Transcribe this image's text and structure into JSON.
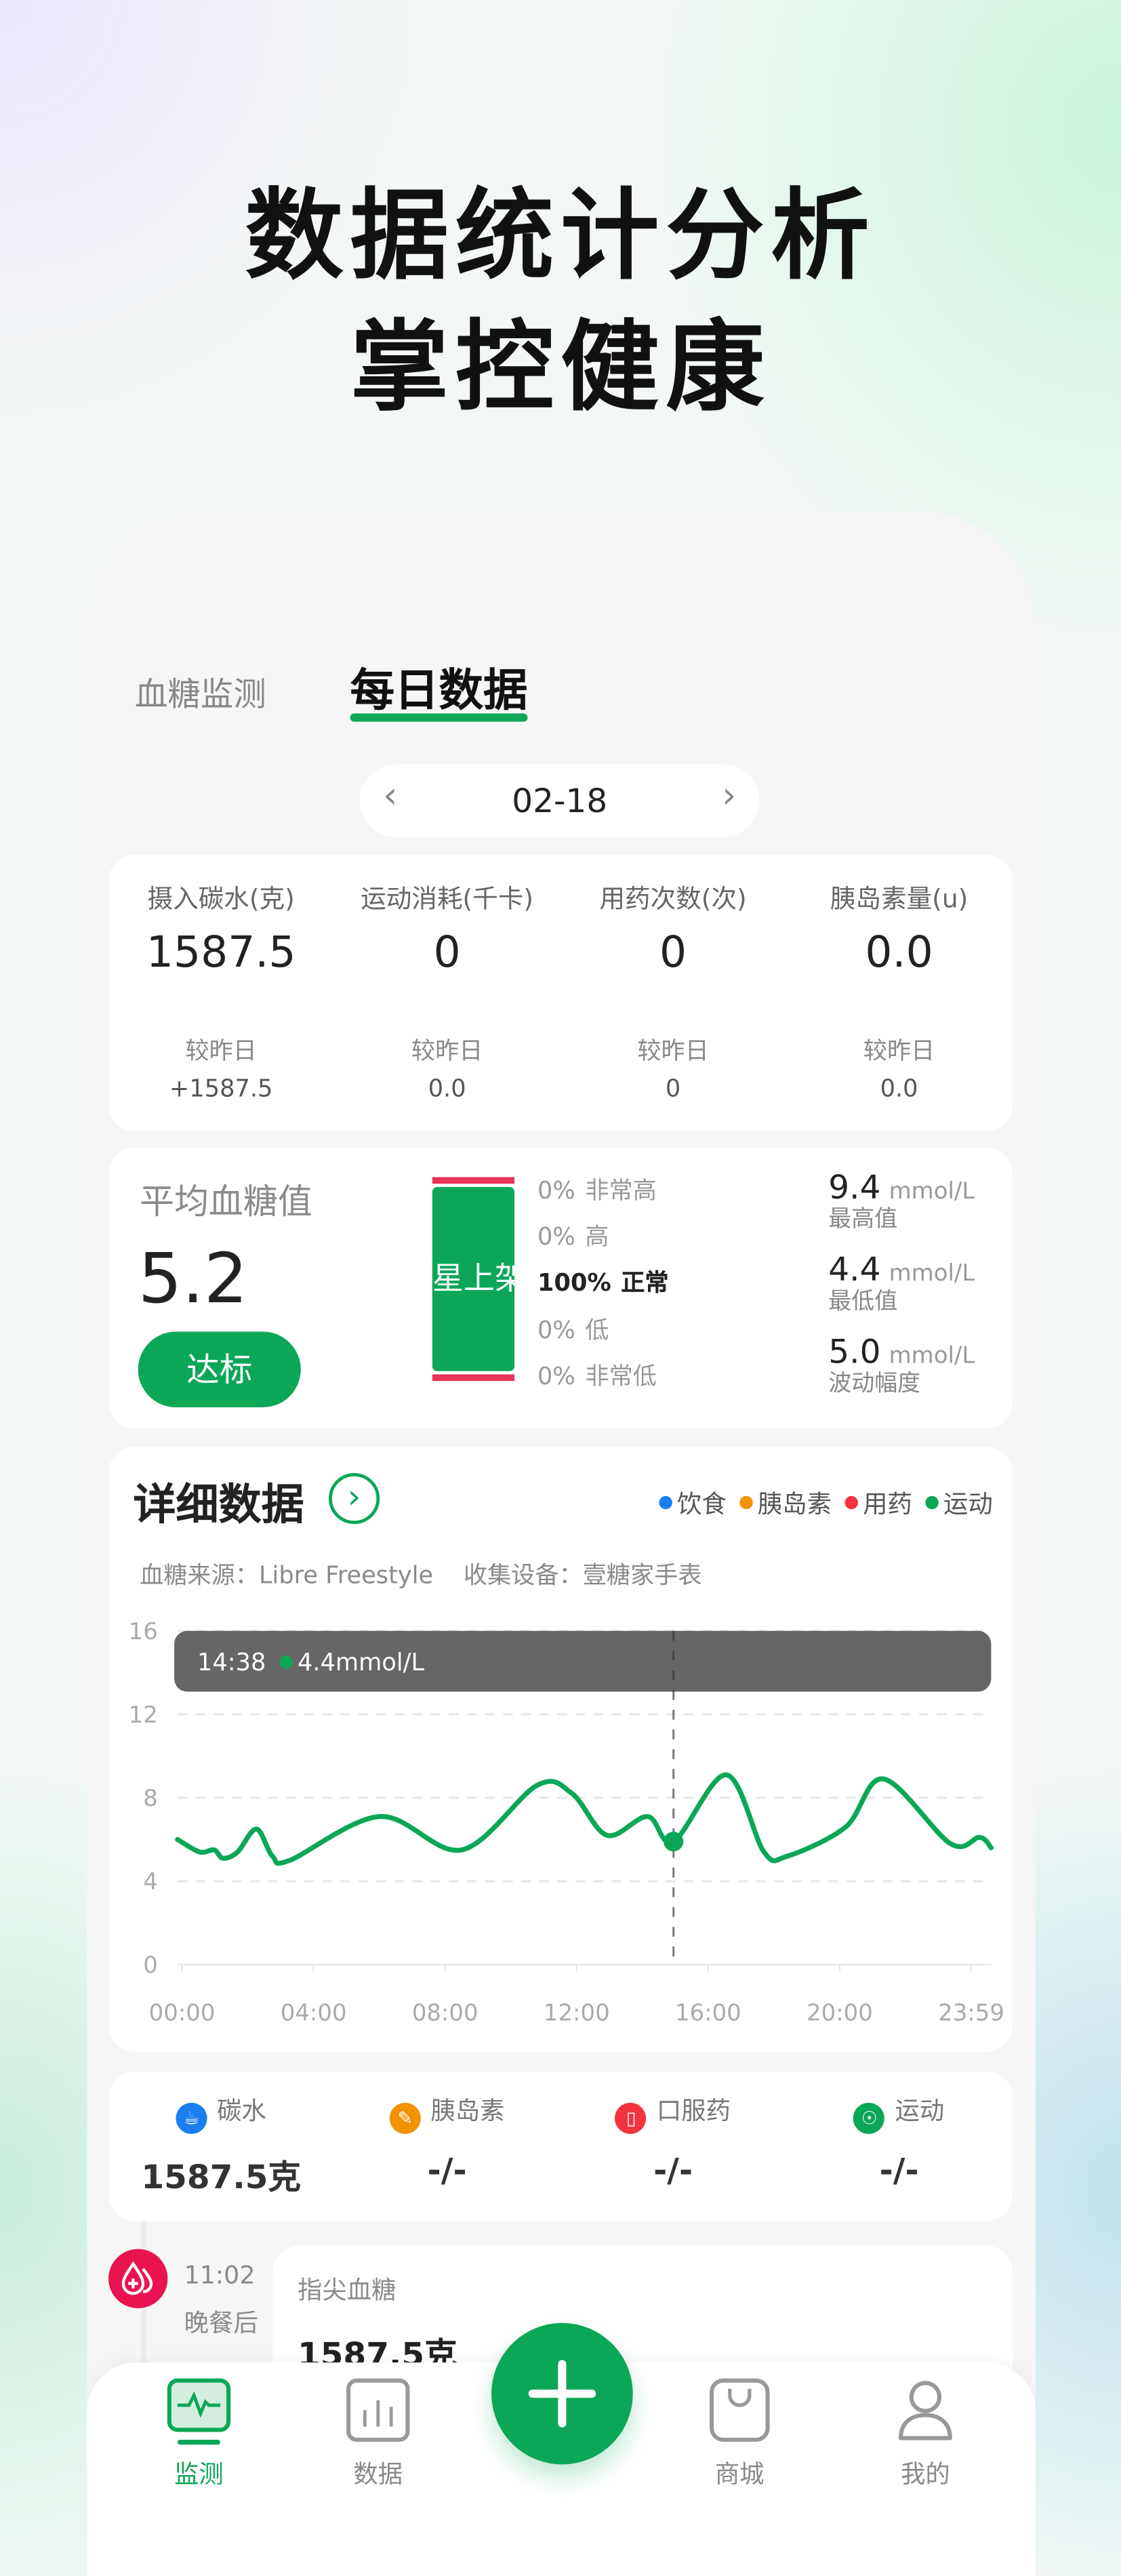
{
  "headline": {
    "line1": "数据统计分析",
    "line2": "掌控健康"
  },
  "tabs": [
    {
      "label": "血糖监测",
      "active": false
    },
    {
      "label": "每日数据",
      "active": true
    }
  ],
  "date_picker": {
    "value": "02-18",
    "prev_icon": "chevron-left-icon",
    "next_icon": "chevron-right-icon"
  },
  "stats": [
    {
      "label": "摄入碳水(克)",
      "value": "1587.5",
      "compare_label": "较昨日",
      "compare": "+1587.5"
    },
    {
      "label": "运动消耗(千卡)",
      "value": "0",
      "compare_label": "较昨日",
      "compare": "0.0"
    },
    {
      "label": "用药次数(次)",
      "value": "0",
      "compare_label": "较昨日",
      "compare": "0"
    },
    {
      "label": "胰岛素量(u)",
      "value": "0.0",
      "compare_label": "较昨日",
      "compare": "0.0"
    }
  ],
  "average": {
    "title": "平均血糖值",
    "value": "5.2",
    "badge": "达标",
    "bar_overlay": "星上架",
    "ranges": [
      {
        "pct": "0%",
        "label": "非常高"
      },
      {
        "pct": "0%",
        "label": "高"
      },
      {
        "pct": "100%",
        "label": "正常"
      },
      {
        "pct": "0%",
        "label": "低"
      },
      {
        "pct": "0%",
        "label": "非常低"
      }
    ],
    "metrics": [
      {
        "value": "9.4",
        "unit": "mmol/L",
        "label": "最高值"
      },
      {
        "value": "4.4",
        "unit": "mmol/L",
        "label": "最低值"
      },
      {
        "value": "5.0",
        "unit": "mmol/L",
        "label": "波动幅度"
      }
    ],
    "colors": {
      "normal": "#0ba757",
      "extreme": "#e8305a"
    }
  },
  "detail": {
    "title": "详细数据",
    "source": "血糖来源：Libre Freestyle",
    "device": "收集设备：壹糖家手表",
    "legend": [
      {
        "label": "饮食",
        "color": "#1a7ef0"
      },
      {
        "label": "胰岛素",
        "color": "#f39200"
      },
      {
        "label": "用药",
        "color": "#f5333f"
      },
      {
        "label": "运动",
        "color": "#0ba757"
      }
    ],
    "tooltip": {
      "time": "14:38",
      "value": "4.4mmol/L"
    }
  },
  "chart_data": {
    "type": "line",
    "x_unit": "hour of day",
    "xlim": [
      0,
      24
    ],
    "ylim": [
      0,
      16
    ],
    "x_ticks": [
      "00:00",
      "04:00",
      "08:00",
      "12:00",
      "16:00",
      "20:00",
      "23:59"
    ],
    "y_ticks": [
      "0",
      "4",
      "8",
      "12",
      "16"
    ],
    "grid": "horizontal dashed",
    "line_color": "#0ba757",
    "x": [
      0,
      0.65,
      1.08,
      1.34,
      1.77,
      2.33,
      2.8,
      3.31,
      5.97,
      8.38,
      10.61,
      11.64,
      12.67,
      13.87,
      14.63,
      16.19,
      17.3,
      17.99,
      19.71,
      20.83,
      22.8,
      23.66,
      24
    ],
    "y": [
      6.0,
      5.4,
      5.5,
      5.1,
      5.4,
      6.5,
      5.2,
      5.0,
      7.1,
      5.5,
      8.6,
      8.2,
      6.2,
      7.1,
      5.9,
      9.1,
      5.4,
      5.2,
      6.6,
      8.9,
      5.8,
      6.1,
      5.6
    ],
    "marker": {
      "x": 14.63,
      "y": 5.9
    }
  },
  "summary": [
    {
      "icon": "carb-icon",
      "label": "碳水",
      "value": "1587.5克",
      "color": "#1a7ef0"
    },
    {
      "icon": "syringe-icon",
      "label": "胰岛素",
      "value": "-/-",
      "color": "#f39200"
    },
    {
      "icon": "pill-icon",
      "label": "口服药",
      "value": "-/-",
      "color": "#f5333f"
    },
    {
      "icon": "running-icon",
      "label": "运动",
      "value": "-/-",
      "color": "#0ba757"
    }
  ],
  "record": {
    "time": "11:02",
    "period": "晚餐后",
    "type": "指尖血糖",
    "value": "1587.5克"
  },
  "nav": [
    {
      "label": "监测",
      "active": true
    },
    {
      "label": "数据"
    },
    {
      "label": "商城"
    },
    {
      "label": "我的"
    }
  ]
}
